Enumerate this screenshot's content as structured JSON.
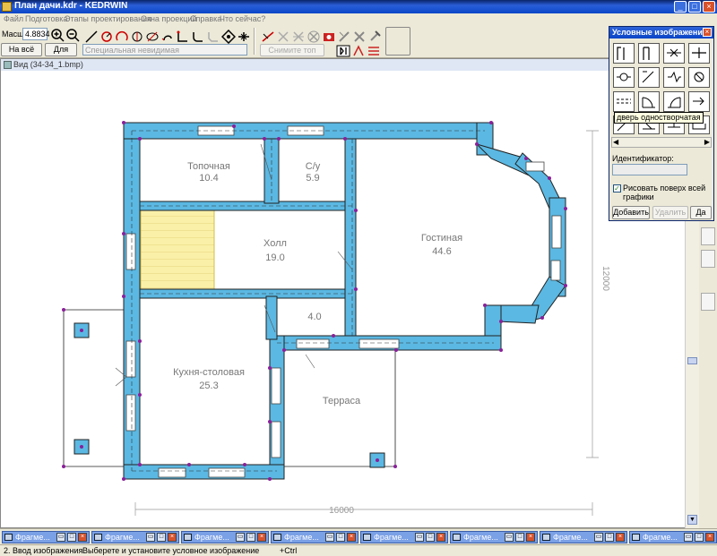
{
  "window": {
    "title": "План дачи.kdr - KEDRWIN",
    "minimize": "_",
    "maximize": "□",
    "close": "×"
  },
  "menu": [
    "Файл",
    "Подготовка",
    "Этапы проектирования",
    "Окна проекций",
    "Справка",
    "Что сейчас?"
  ],
  "toolbar": {
    "scale_label": "Масшт",
    "scale_value": "4.8834",
    "fit_all_label": "На всё окно",
    "fit_all2_label": "Для всех",
    "line_type_value": "Специальная невидимая",
    "remove_top_label": "Снимите топ линии"
  },
  "drawing": {
    "window_title": "Вид (34-34_1.bmp)",
    "rooms": [
      {
        "name": "Топочная",
        "area": "10.4"
      },
      {
        "name": "С/у",
        "area": "5.9"
      },
      {
        "name": "Холл",
        "area": "19.0"
      },
      {
        "name": "Гостиная",
        "area": "44.6"
      },
      {
        "name": "",
        "area": "4.0"
      },
      {
        "name": "Кухня-столовая",
        "area": "25.3"
      },
      {
        "name": "Терраса",
        "area": ""
      }
    ],
    "dim_horizontal": "16000",
    "dim_vertical": "12000"
  },
  "panel": {
    "title": "Условные изображения",
    "tooltip": "дверь одностворчатая",
    "identifier_label": "Идентификатор:",
    "identifier_value": "",
    "checkbox_label": "Рисовать поверх всей графики",
    "checkbox_checked": true,
    "add_button": "Добавить",
    "delete_button": "Удалить",
    "yes_button": "Да"
  },
  "fragments": [
    "Фрагме...",
    "Фрагме...",
    "Фрагме...",
    "Фрагме...",
    "Фрагме...",
    "Фрагме...",
    "Фрагме...",
    "Фрагме..."
  ],
  "status": {
    "step": "2. Ввод изображения",
    "hint": "Выберете и установите условное изображение",
    "modifier": "+Ctrl"
  }
}
